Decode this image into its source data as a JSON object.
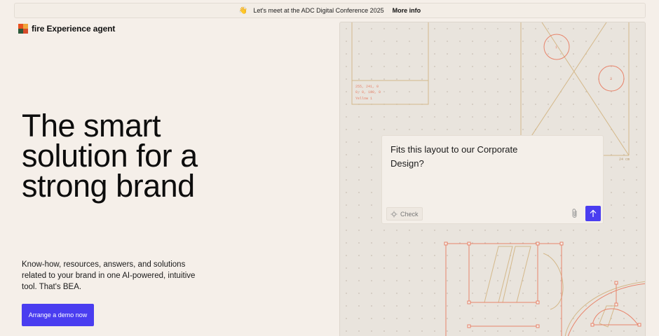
{
  "announcement": {
    "emoji": "👋",
    "text": "Let's meet at the ADC Digital Conference 2025",
    "link": "More info"
  },
  "brand": {
    "name": "fire Experience agent",
    "colors": [
      "#e8501f",
      "#f0a63c",
      "#2c5a3a",
      "#d64b2a"
    ]
  },
  "hero": {
    "headline_lines": [
      "The smart",
      "solution for a",
      "strong brand"
    ],
    "description": "Know-how, resources, answers, and solutions related to your brand in one AI-powered, intuitive tool. That's BEA.",
    "cta": "Arrange a demo now"
  },
  "panel": {
    "swatch_lines": [
      "255, 241, 0",
      "0, 0, 100, 0",
      "Yellow 1"
    ],
    "circle_labels": [
      "1",
      "2"
    ],
    "dimension_label": "24 cm",
    "chat": {
      "prompt_lines": [
        "Fits this layout to our Corporate",
        "Design?"
      ],
      "check_label": "Check"
    }
  },
  "colors": {
    "accent": "#4a3df0",
    "background": "#f5efe9",
    "guide_lines": "#e8836a",
    "frame_lines": "#d4b88a"
  }
}
